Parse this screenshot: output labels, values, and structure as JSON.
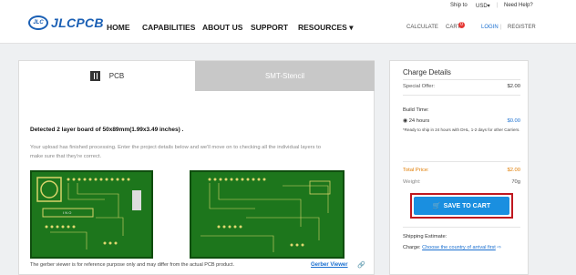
{
  "header": {
    "logo_badge": "JLC",
    "logo_text": "JLCPCB",
    "nav": [
      "HOME",
      "CAPABILITIES",
      "ABOUT US",
      "SUPPORT",
      "RESOURCES ▾"
    ],
    "ship_to": "Ship to",
    "currency": "USD▾",
    "divider": "|",
    "need_help": "Need Help?",
    "calculate": "CALCULATE",
    "cart": "CART",
    "cart_count": "0",
    "login": "LOGIN",
    "register": "REGISTER"
  },
  "tabs": {
    "pcb": "PCB",
    "smt": "SMT-Stencil"
  },
  "main": {
    "detected": "Detected 2 layer board of 50x89mm(1.99x3.49 inches) .",
    "description": "Your upload has finished processing. Enter the project details below and we'll move on to checking all the individual layers to make sure that they're correct.",
    "viewer_note": "The gerber viewer is for reference purpose only and may differ from the actual PCB product.",
    "gerber_viewer": "Gerber Viewer"
  },
  "charge": {
    "title": "Charge Details",
    "special_offer_label": "Special Offer:",
    "special_offer_value": "$2.00",
    "build_time_label": "Build Time:",
    "build_time_option": "24 hours",
    "build_time_price": "$0.00",
    "build_time_note": "*Ready to ship in 24 hours with DHL, 1-2 days for other Carriers.",
    "total_label": "Total Price:",
    "total_value": "$2.00",
    "weight_label": "Weight:",
    "weight_value": "70g",
    "save_button": "SAVE TO CART",
    "shipping_label": "Shipping Estimate:",
    "charge_label": "Charge:",
    "charge_link": "Choose the country of arrival first"
  },
  "colors": {
    "brand": "#1a5fb4",
    "accent": "#1a8fe0",
    "highlight": "#c0181f",
    "total": "#e07b00"
  }
}
